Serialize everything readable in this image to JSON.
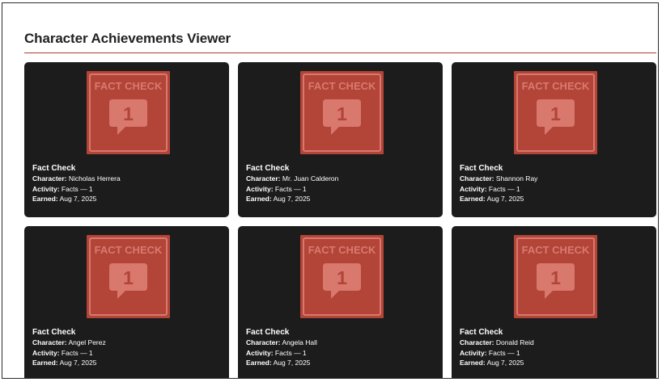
{
  "page": {
    "title": "Character Achievements Viewer"
  },
  "labels": {
    "character": "Character:",
    "activity": "Activity:",
    "earned": "Earned:"
  },
  "colors": {
    "accent": "#b03a34",
    "card_bg": "#1c1c1c",
    "badge_bg": "#b24438"
  },
  "achievements": [
    {
      "name": "Fact Check",
      "badge_text": "FACT CHECK",
      "badge_count": "1",
      "character": "Nicholas Herrera",
      "activity": "Facts — 1",
      "earned": "Aug 7, 2025"
    },
    {
      "name": "Fact Check",
      "badge_text": "FACT CHECK",
      "badge_count": "1",
      "character": "Mr. Juan Calderon",
      "activity": "Facts — 1",
      "earned": "Aug 7, 2025"
    },
    {
      "name": "Fact Check",
      "badge_text": "FACT CHECK",
      "badge_count": "1",
      "character": "Shannon Ray",
      "activity": "Facts — 1",
      "earned": "Aug 7, 2025"
    },
    {
      "name": "Fact Check",
      "badge_text": "FACT CHECK",
      "badge_count": "1",
      "character": "Angel Perez",
      "activity": "Facts — 1",
      "earned": "Aug 7, 2025"
    },
    {
      "name": "Fact Check",
      "badge_text": "FACT CHECK",
      "badge_count": "1",
      "character": "Angela Hall",
      "activity": "Facts — 1",
      "earned": "Aug 7, 2025"
    },
    {
      "name": "Fact Check",
      "badge_text": "FACT CHECK",
      "badge_count": "1",
      "character": "Donald Reid",
      "activity": "Facts — 1",
      "earned": "Aug 7, 2025"
    }
  ]
}
